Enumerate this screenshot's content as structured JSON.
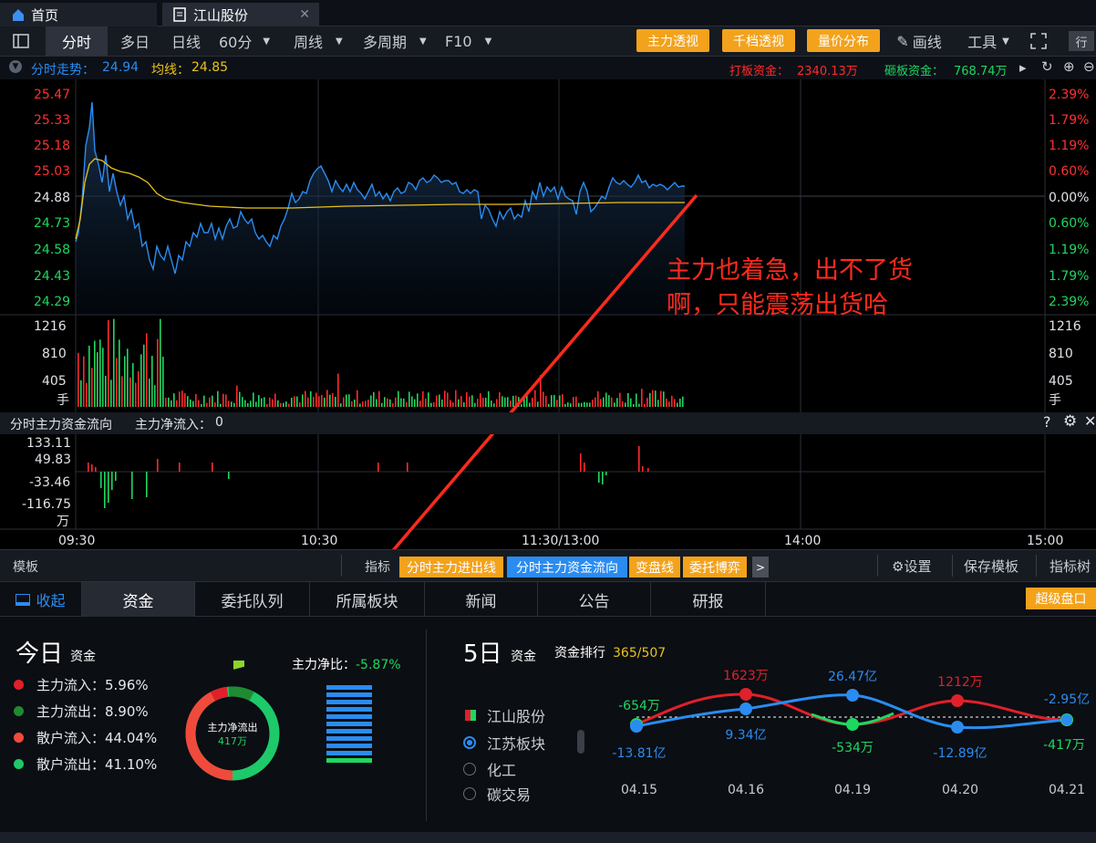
{
  "tabs": {
    "home": "首页",
    "stock": "江山股份"
  },
  "toolbar": {
    "fenshi": "分时",
    "duori": "多日",
    "rixian": "日线",
    "min60": "60分",
    "zhouxian": "周线",
    "duozhouqi": "多周期",
    "f10": "F10",
    "zhuli": "主力透视",
    "qiandang": "千档透视",
    "liangjia": "量价分布",
    "huaxian": "画线",
    "gongju": "工具",
    "hang": "行"
  },
  "info": {
    "trend_label": "分时走势：",
    "trend_value": "24.94",
    "avg_label": "均线：",
    "avg_value": "24.85",
    "daban_label": "打板资金：",
    "daban_value": "2340.13万",
    "zaban_label": "砸板资金：",
    "zaban_value": "768.74万"
  },
  "price_axis": {
    "left": [
      "25.47",
      "25.33",
      "25.18",
      "25.03",
      "24.88",
      "24.73",
      "24.58",
      "24.43",
      "24.29"
    ],
    "right": [
      "2.39%",
      "1.79%",
      "1.19%",
      "0.60%",
      "0.00%",
      "0.60%",
      "1.19%",
      "1.79%",
      "2.39%"
    ]
  },
  "volume_axis": [
    "1216",
    "810",
    "405",
    "手"
  ],
  "fund": {
    "title": "分时主力资金流向",
    "net_label": "主力净流入：",
    "net_value": "0",
    "axis": [
      "133.11",
      "49.83",
      "-33.46",
      "-116.75",
      "万"
    ]
  },
  "time_axis": [
    "09:30",
    "10:30",
    "11:30/13:00",
    "14:00",
    "15:00"
  ],
  "annotation": {
    "line1": "主力也着急，出不了货",
    "line2": "啊，只能震荡出货哈"
  },
  "template_bar": {
    "label": "模板",
    "indicator_label": "指标",
    "ind1": "分时主力进出线",
    "ind2": "分时主力资金流向",
    "ind3": "变盘线",
    "ind4": "委托博弈",
    "settings": "设置",
    "save": "保存模板",
    "indicator_tree": "指标树"
  },
  "subtabs": {
    "collapse": "收起",
    "zijin": "资金",
    "weituo": "委托队列",
    "suoshu": "所属板块",
    "xinwen": "新闻",
    "gonggao": "公告",
    "yanbao": "研报",
    "chaoji": "超级盘口"
  },
  "today": {
    "title": "今日",
    "subtitle": "资金",
    "legend": [
      {
        "label": "主力流入：5.96%",
        "color": "#e0202a"
      },
      {
        "label": "主力流出：8.90%",
        "color": "#1f8a32"
      },
      {
        "label": "散户流入：44.04%",
        "color": "#f04a3c"
      },
      {
        "label": "散户流出：41.10%",
        "color": "#1ec96a"
      }
    ],
    "donut_label": "主力净流出",
    "donut_value": "417万",
    "ratio_label": "主力净比：",
    "ratio_value": "-5.87%"
  },
  "five_day": {
    "title": "5日",
    "subtitle": "资金",
    "rank_label": "资金排行",
    "rank_value": "365/507",
    "stock": "江山股份",
    "options": [
      "江苏板块",
      "化工",
      "碳交易"
    ],
    "dates": [
      "04.15",
      "04.16",
      "04.19",
      "04.20",
      "04.21"
    ],
    "main_labels": [
      "-654万",
      "1623万",
      "-534万",
      "1212万",
      "-417万"
    ],
    "sector_labels": [
      "-13.81亿",
      "9.34亿",
      "26.47亿",
      "-12.89亿",
      "-2.95亿"
    ]
  },
  "colors": {
    "up": "#ff2a2a",
    "down": "#1ed760",
    "blue": "#2a8cf0",
    "orange": "#f3a21c",
    "yellow": "#e8c21c"
  }
}
